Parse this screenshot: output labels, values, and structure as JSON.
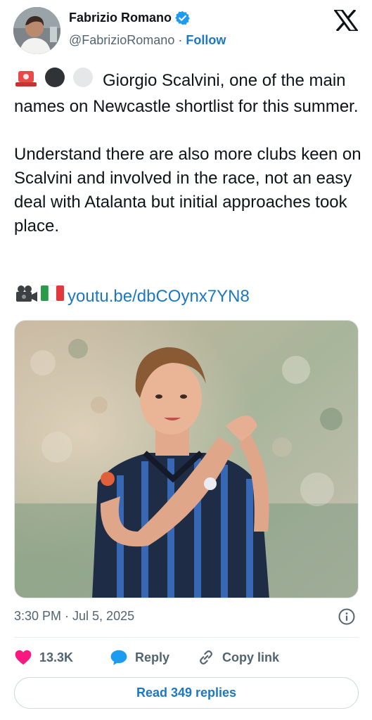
{
  "author": {
    "name": "Fabrizio Romano",
    "handle": "@FabrizioRomano",
    "separator": "·",
    "follow_label": "Follow"
  },
  "tweet": {
    "paragraph1": "Giorgio Scalvini, one of the main names on Newcastle shortlist for this summer.",
    "paragraph2": "Understand there are also more clubs keen on Scalvini and involved in the race, not an easy deal with Atalanta but initial approaches took place.",
    "link": "youtu.be/dbCOynx7YN8",
    "emojis_lead": [
      "police-light-emoji",
      "black-circle-emoji",
      "white-circle-emoji"
    ],
    "emojis_link": [
      "video-camera-emoji",
      "italy-flag-emoji"
    ]
  },
  "meta": {
    "timestamp": "3:30 PM · Jul 5, 2025"
  },
  "actions": {
    "like_count": "13.3K",
    "reply_label": "Reply",
    "copy_label": "Copy link"
  },
  "read_replies_label": "Read 349 replies",
  "colors": {
    "link": "#1d77c2",
    "like": "#f91880",
    "reply": "#1d9bf0",
    "text": "#0f1419",
    "muted": "#536471"
  }
}
